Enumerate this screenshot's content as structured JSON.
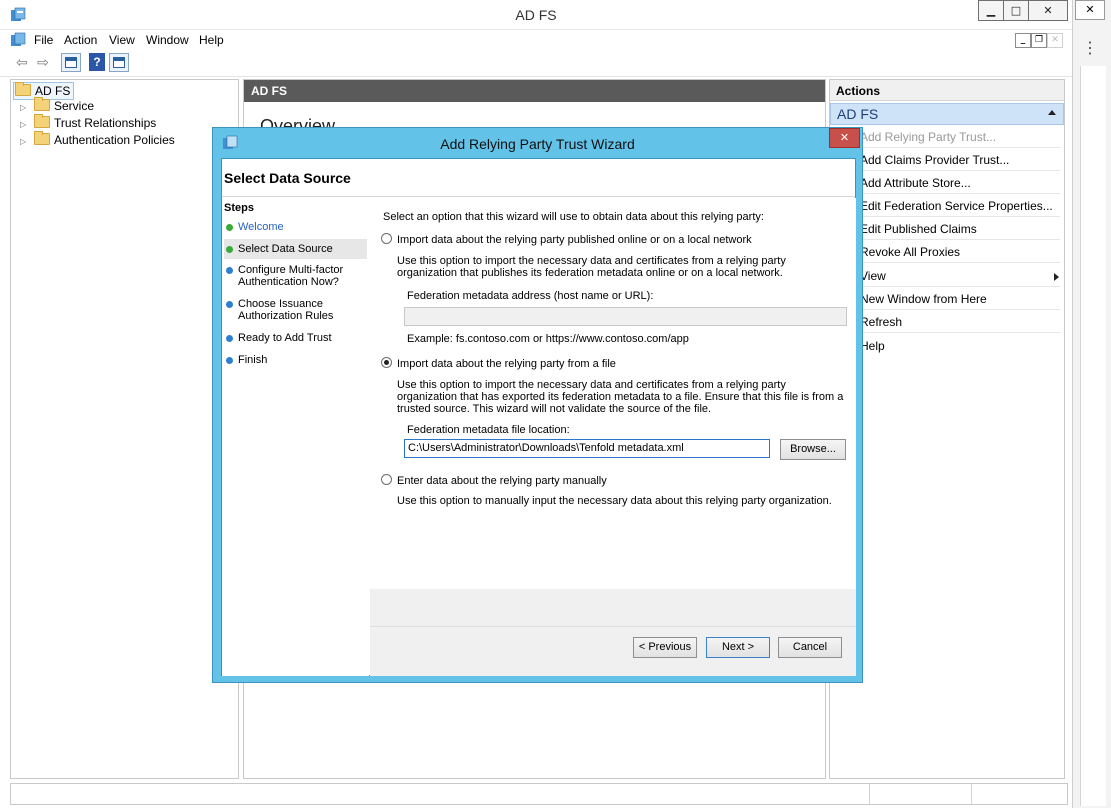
{
  "app": {
    "title": "AD FS"
  },
  "menu": [
    "File",
    "Action",
    "View",
    "Window",
    "Help"
  ],
  "tree": {
    "root": "AD FS",
    "items": [
      "Service",
      "Trust Relationships",
      "Authentication Policies"
    ]
  },
  "center": {
    "header": "AD FS",
    "overview": "Overview"
  },
  "actions": {
    "header": "Actions",
    "group": "AD FS",
    "items": [
      "Add Relying Party Trust...",
      "Add Claims Provider Trust...",
      "Add Attribute Store...",
      "Edit Federation Service Properties...",
      "Edit Published Claims",
      "Revoke All Proxies",
      "View",
      "New Window from Here",
      "Refresh",
      "Help"
    ]
  },
  "wizard": {
    "title": "Add Relying Party Trust Wizard",
    "page_title": "Select Data Source",
    "steps_label": "Steps",
    "steps": [
      "Welcome",
      "Select Data Source",
      "Configure Multi-factor Authentication Now?",
      "Choose Issuance Authorization Rules",
      "Ready to Add Trust",
      "Finish"
    ],
    "intro": "Select an option that this wizard will use to obtain data about this relying party:",
    "option_online": {
      "label": "Import data about the relying party published online or on a local network",
      "description": "Use this option to import the necessary data and certificates from a relying party organization that publishes its federation metadata online or on a local network.",
      "field_label": "Federation metadata address (host name or URL):",
      "field_value": "",
      "example": "Example: fs.contoso.com or https://www.contoso.com/app"
    },
    "option_file": {
      "label": "Import data about the relying party from a file",
      "description": "Use this option to import the necessary data and certificates from a relying party organization that has exported its federation metadata to a file. Ensure that this file is from a trusted source.  This wizard will not validate the source of the file.",
      "field_label": "Federation metadata file location:",
      "field_value": "C:\\Users\\Administrator\\Downloads\\Tenfold metadata.xml",
      "browse": "Browse..."
    },
    "option_manual": {
      "label": "Enter data about the relying party manually",
      "description": "Use this option to manually input the necessary data about this relying party organization."
    },
    "buttons": {
      "previous": "< Previous",
      "next": "Next >",
      "cancel": "Cancel"
    }
  }
}
